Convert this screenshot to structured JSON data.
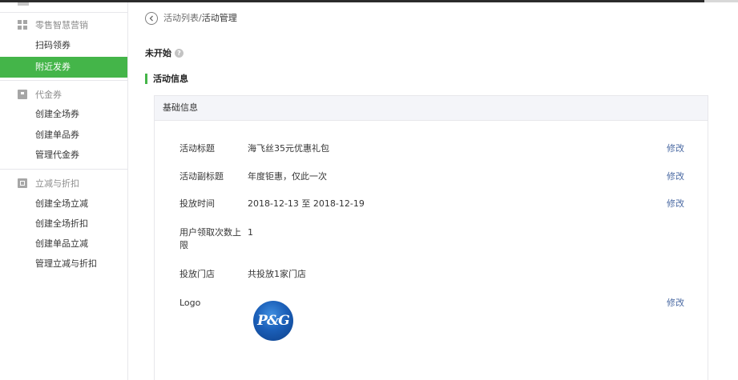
{
  "sidebar": {
    "groups": [
      {
        "label": "零售智慧营销",
        "icon": "grid-icon",
        "items": [
          {
            "label": "扫码领券",
            "active": false
          },
          {
            "label": "附近发券",
            "active": true
          }
        ]
      },
      {
        "label": "代金券",
        "icon": "voucher-icon",
        "items": [
          {
            "label": "创建全场券",
            "active": false
          },
          {
            "label": "创建单品券",
            "active": false
          },
          {
            "label": "管理代金券",
            "active": false
          }
        ]
      },
      {
        "label": "立减与折扣",
        "icon": "discount-icon",
        "items": [
          {
            "label": "创建全场立减",
            "active": false
          },
          {
            "label": "创建全场折扣",
            "active": false
          },
          {
            "label": "创建单品立减",
            "active": false
          },
          {
            "label": "管理立减与折扣",
            "active": false
          }
        ]
      }
    ]
  },
  "breadcrumb": {
    "parent": "活动列表",
    "separator": "/",
    "current": "活动管理"
  },
  "status": {
    "label": "未开始",
    "help_icon": "?"
  },
  "section_title": "活动信息",
  "panel": {
    "title": "基础信息",
    "rows": [
      {
        "label": "活动标题",
        "value": "海飞丝35元优惠礼包",
        "edit": "修改"
      },
      {
        "label": "活动副标题",
        "value": "年度钜惠，仅此一次",
        "edit": "修改"
      },
      {
        "label": "投放时间",
        "value": "2018-12-13 至 2018-12-19",
        "edit": "修改"
      },
      {
        "label": "用户领取次数上限",
        "value": "1",
        "edit": ""
      },
      {
        "label": "投放门店",
        "value": "共投放1家门店",
        "edit": ""
      },
      {
        "label": "Logo",
        "value": "",
        "edit": "修改"
      }
    ],
    "logo_text": "P&G"
  },
  "colors": {
    "accent_green": "#44b549",
    "link_blue": "#4b6aa3",
    "panel_header_bg": "#f4f5f9",
    "border": "#e7e7eb"
  }
}
